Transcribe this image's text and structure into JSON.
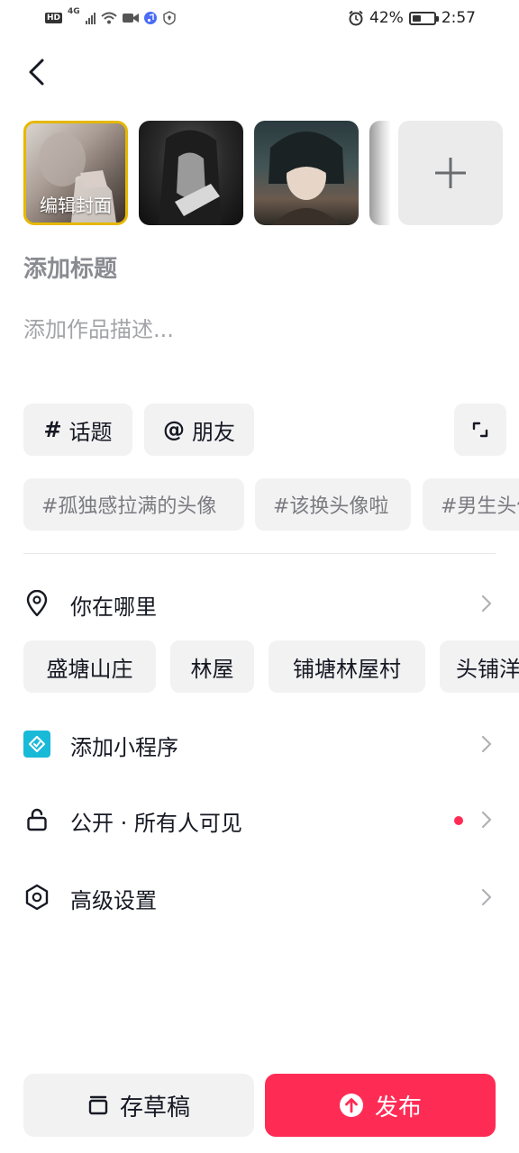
{
  "status_bar": {
    "network_badge": "HD",
    "network_type": "4G",
    "battery_percent": "42%",
    "battery_level": 0.42,
    "time": "2:57"
  },
  "cover": {
    "edit_label": "编辑封面"
  },
  "form": {
    "title_placeholder": "添加标题",
    "description_placeholder": "添加作品描述..."
  },
  "chips": {
    "topic_glyph": "#",
    "topic_label": "话题",
    "friend_glyph": "@",
    "friend_label": "朋友"
  },
  "suggested_tags": [
    "#孤独感拉满的头像",
    "#该换头像啦",
    "#男生头像"
  ],
  "location": {
    "label": "你在哪里",
    "suggestions": [
      "盛塘山庄",
      "林屋",
      "铺塘林屋村",
      "头铺洋"
    ]
  },
  "mini_program": {
    "label": "添加小程序"
  },
  "privacy": {
    "label": "公开 · 所有人可见"
  },
  "advanced": {
    "label": "高级设置"
  },
  "actions": {
    "draft_label": "存草稿",
    "publish_label": "发布"
  },
  "colors": {
    "accent": "#fe2c55",
    "chip_bg": "#f2f2f3",
    "mini_program": "#19b9d8",
    "cover_border": "#e6b800"
  }
}
